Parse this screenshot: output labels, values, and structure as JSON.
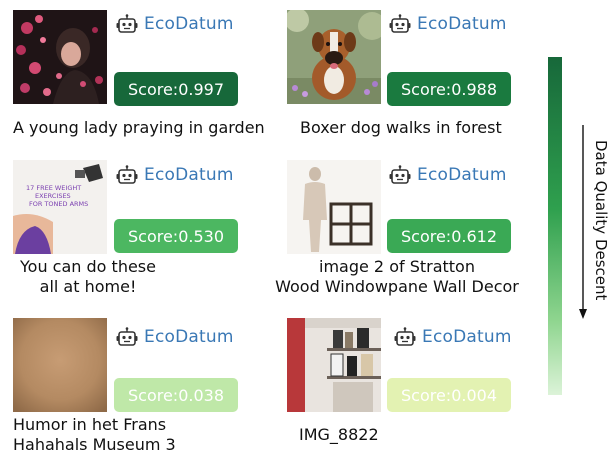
{
  "brand": {
    "name": "EcoDatum",
    "icon": "robot-icon"
  },
  "axis": {
    "label": "Data Quality Descent"
  },
  "items": [
    {
      "score": "Score:0.997",
      "caption": [
        "A young lady praying in garden"
      ],
      "score_color": "#17683a"
    },
    {
      "score": "Score:0.988",
      "caption": [
        "Boxer dog walks in forest"
      ],
      "score_color": "#1a7a3f"
    },
    {
      "score": "Score:0.530",
      "caption": [
        "You can do these",
        "all at home!"
      ],
      "score_color": "#4cb761"
    },
    {
      "score": "Score:0.612",
      "caption": [
        "image 2 of Stratton",
        "Wood Windowpane Wall Decor"
      ],
      "score_color": "#3aa955"
    },
    {
      "score": "Score:0.038",
      "caption": [
        "Humor in het Frans",
        "Hahahals Museum 3"
      ],
      "score_color": "#bfe8a8"
    },
    {
      "score": "Score:0.004",
      "caption": [
        "IMG_8822"
      ],
      "score_color": "#e3f2b2"
    }
  ],
  "thumbnail_text": {
    "fitness": [
      "17 FREE WEIGHT",
      "EXERCISES",
      "FOR TONED ARMS"
    ]
  }
}
